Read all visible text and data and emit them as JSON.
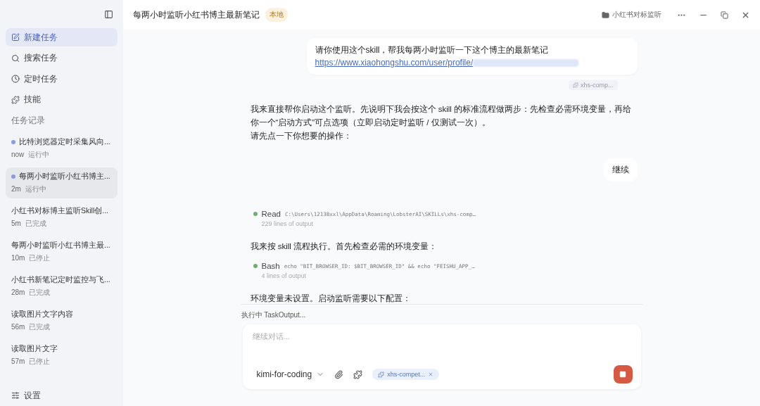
{
  "sidebar": {
    "nav": [
      {
        "label": "新建任务",
        "selected": true
      },
      {
        "label": "搜索任务",
        "selected": false
      },
      {
        "label": "定时任务",
        "selected": false
      },
      {
        "label": "技能",
        "selected": false
      }
    ],
    "section_title": "任务记录",
    "tasks": [
      {
        "title": "比特浏览器定时采集风向...",
        "time": "now",
        "status": "运行中",
        "running": true,
        "selected": false
      },
      {
        "title": "每两小时监听小红书博主...",
        "time": "2m",
        "status": "运行中",
        "running": true,
        "selected": true
      },
      {
        "title": "小红书对标博主监听Skill创...",
        "time": "5m",
        "status": "已完成",
        "running": false,
        "selected": false
      },
      {
        "title": "每两小时监听小红书博主最...",
        "time": "10m",
        "status": "已停止",
        "running": false,
        "selected": false
      },
      {
        "title": "小红书新笔记定时监控与飞...",
        "time": "28m",
        "status": "已完成",
        "running": false,
        "selected": false
      },
      {
        "title": "读取图片文字内容",
        "time": "56m",
        "status": "已完成",
        "running": false,
        "selected": false
      },
      {
        "title": "读取图片文字",
        "time": "57m",
        "status": "已停止",
        "running": false,
        "selected": false
      }
    ],
    "settings": "设置"
  },
  "header": {
    "title": "每两小时监听小红书博主最新笔记",
    "badge": "本地",
    "folder": "小红书对标监听"
  },
  "messages": [
    {
      "kind": "user",
      "text": "请你使用这个skill，帮我每两小时监听一下这个博主的最新笔记",
      "link": "https://www.xiaohongshu.com/user/profile/",
      "tag": "xhs-comp..."
    },
    {
      "kind": "assistant",
      "paragraphs": [
        "我来直接帮你启动这个监听。先说明下我会按这个 skill 的标准流程做两步：先检查必需环境变量，再给你一个“启动方式”可点选项（立即启动定时监听 / 仅测试一次）。",
        "请先点一下你想要的操作："
      ]
    },
    {
      "kind": "choice",
      "label": "继续"
    },
    {
      "kind": "tool",
      "name": "Read",
      "command": "C:\\Users\\12138xxl\\AppData\\Roaming\\LobsterAI\\SKILLs\\xhs-comp…",
      "output": "229 lines of output"
    },
    {
      "kind": "assistant",
      "paragraphs": [
        "我来按 skill 流程执行。首先检查必需的环境变量："
      ]
    },
    {
      "kind": "tool",
      "name": "Bash",
      "command": "echo \"BIT_BROWSER_ID: $BIT_BROWSER_ID\" && echo \"FEISHU_APP_…",
      "output": "4 lines of output"
    },
    {
      "kind": "assistant",
      "paragraphs": [
        "环境变量未设置。启动监听需要以下配置："
      ]
    }
  ],
  "status": "执行中 TaskOutput...",
  "composer": {
    "placeholder": "继续对话...",
    "model": "kimi-for-coding",
    "skill_chip": "xhs-compet...",
    "running": true
  }
}
